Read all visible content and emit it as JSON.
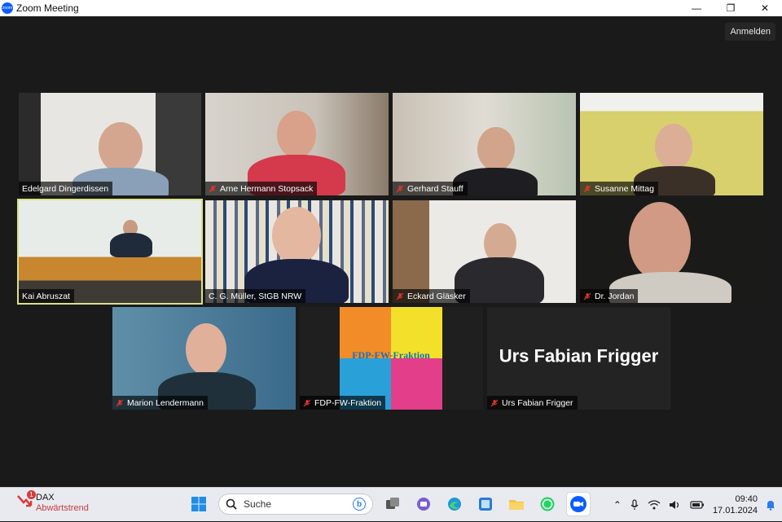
{
  "window": {
    "title": "Zoom Meeting",
    "minimize": "—",
    "maximize": "❐",
    "close": "✕"
  },
  "signin_label": "Anmelden",
  "participants": [
    {
      "name": "Edelgard Dingerdissen",
      "muted": false
    },
    {
      "name": "Arne Hermann Stopsack",
      "muted": true
    },
    {
      "name": "Gerhard Stauff",
      "muted": true
    },
    {
      "name": "Susanne Mittag",
      "muted": true
    },
    {
      "name": "Kai Abruszat",
      "muted": false,
      "active_speaker": true
    },
    {
      "name": "C. G. Müller, StGB NRW",
      "muted": true
    },
    {
      "name": "Eckard Gläsker",
      "muted": true
    },
    {
      "name": "Dr. Jordan",
      "muted": true
    },
    {
      "name": "Marion Lendermann",
      "muted": true
    },
    {
      "name": "FDP-FW-Fraktion",
      "muted": true
    },
    {
      "name": "Urs Fabian Frigger",
      "muted": true,
      "camera_off": true
    }
  ],
  "fraktion_logo_text": "FDP-FW-Fraktion",
  "camera_off_display_name": "Urs Fabian Frigger",
  "taskbar": {
    "weather": {
      "title": "DAX",
      "subtitle": "Abwärtstrend",
      "badge": "1"
    },
    "search_placeholder": "Suche",
    "search_badge": "b",
    "clock": {
      "time": "09:40",
      "date": "17.01.2024"
    }
  },
  "colors": {
    "active_speaker": "#d8e28a",
    "muted_icon": "#e0362c",
    "zoom_blue": "#0b5cff"
  }
}
